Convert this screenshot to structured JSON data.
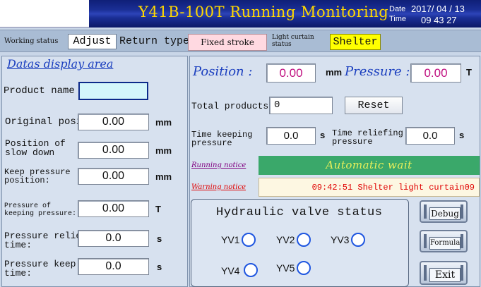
{
  "header": {
    "title": "Y41B-100T Running Monitoring",
    "date_label": "Date",
    "time_label": "Time",
    "date_value": "2017/ 04 / 13",
    "time_value": "09  43  27"
  },
  "status_bar": {
    "working_status_label": "Working status",
    "working_status_value": "Adjust",
    "return_type_label": "Return type",
    "return_type_value": "Fixed stroke",
    "light_curtain_label": "Light curtain status",
    "light_curtain_value": "Shelter"
  },
  "left_panel": {
    "title": "Datas display area",
    "product_name_label": "Product name",
    "product_name_value": "",
    "rows": [
      {
        "label": "Original posi",
        "value": "0.00",
        "unit": "mm"
      },
      {
        "label": "Position of\nslow down",
        "value": "0.00",
        "unit": "mm"
      },
      {
        "label": "Keep pressure\nposition:",
        "value": "0.00",
        "unit": "mm"
      },
      {
        "label": "Pressure of\nkeeping pressure:",
        "value": "0.00",
        "unit": "T"
      },
      {
        "label": "Pressure relief\ntime:",
        "value": "0.0",
        "unit": "s"
      },
      {
        "label": "Pressure keep\ntime:",
        "value": "0.0",
        "unit": "s"
      }
    ]
  },
  "right_panel": {
    "position_label": "Position :",
    "position_value": "0.00",
    "position_unit": "mm",
    "pressure_label": "Pressure :",
    "pressure_value": "0.00",
    "pressure_unit": "T",
    "total_products_label": "Total products",
    "total_products_value": "0",
    "reset_label": "Reset",
    "time_keeping_label": "Time keeping\npressure",
    "time_keeping_value": "0.0",
    "time_keeping_unit": "s",
    "time_relief_label": "Time reliefing\npressure",
    "time_relief_value": "0.0",
    "time_relief_unit": "s",
    "running_notice_label": "Running notice",
    "running_notice_value": "Automatic wait",
    "warning_notice_label": "Warning notice",
    "warning_notice_value": "09:42:51  Shelter light curtain09"
  },
  "valves": {
    "title": "Hydraulic valve status",
    "items": [
      "YV1",
      "YV2",
      "YV3",
      "YV4",
      "YV5"
    ]
  },
  "side_buttons": {
    "debug": "Debug",
    "formula": "Formula",
    "exit": "Exit"
  },
  "colors": {
    "title_text": "#ffd800",
    "running_notice_bg": "#3aa86a",
    "warning_text": "#e00000",
    "panel_label_blue": "#1b3fbf",
    "valve_circle": "#1f56e0",
    "product_name_field": "#d4f6fb",
    "light_curtain_bg": "#ffff00",
    "return_type_bg": "#ffd9e1"
  }
}
